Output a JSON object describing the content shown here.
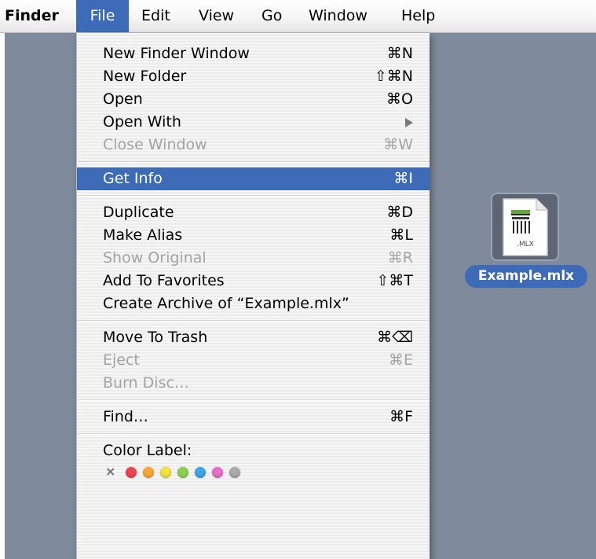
{
  "menubar": {
    "app": "Finder",
    "items": [
      "File",
      "Edit",
      "View",
      "Go",
      "Window",
      "Help"
    ]
  },
  "file_menu": {
    "groups": [
      [
        {
          "label": "New Finder Window",
          "shortcut": "⌘N",
          "enabled": true
        },
        {
          "label": "New Folder",
          "shortcut": "⇧⌘N",
          "enabled": true
        },
        {
          "label": "Open",
          "shortcut": "⌘O",
          "enabled": true
        },
        {
          "label": "Open With",
          "shortcut": "",
          "submenu": true,
          "enabled": true
        },
        {
          "label": "Close Window",
          "shortcut": "⌘W",
          "enabled": false
        }
      ],
      [
        {
          "label": "Get Info",
          "shortcut": "⌘I",
          "enabled": true,
          "highlighted": true
        }
      ],
      [
        {
          "label": "Duplicate",
          "shortcut": "⌘D",
          "enabled": true
        },
        {
          "label": "Make Alias",
          "shortcut": "⌘L",
          "enabled": true
        },
        {
          "label": "Show Original",
          "shortcut": "⌘R",
          "enabled": false
        },
        {
          "label": "Add To Favorites",
          "shortcut": "⇧⌘T",
          "enabled": true
        },
        {
          "label": "Create Archive of “Example.mlx”",
          "shortcut": "",
          "enabled": true
        }
      ],
      [
        {
          "label": "Move To Trash",
          "shortcut": "⌘⌫",
          "enabled": true
        },
        {
          "label": "Eject",
          "shortcut": "⌘E",
          "enabled": false
        },
        {
          "label": "Burn Disc…",
          "shortcut": "",
          "enabled": false
        }
      ],
      [
        {
          "label": "Find…",
          "shortcut": "⌘F",
          "enabled": true
        }
      ],
      [
        {
          "label": "Color Label:",
          "shortcut": "",
          "enabled": true
        }
      ]
    ],
    "color_labels": [
      "none",
      "red",
      "orange",
      "yellow",
      "green",
      "blue",
      "purple",
      "gray"
    ]
  },
  "colors": {
    "highlight": "#3d6bb8",
    "desktop": "#7f8a9c",
    "disabled_text": "#a3a3a3",
    "label_colors": {
      "red": "#f2444f",
      "orange": "#f9a732",
      "yellow": "#f3e33d",
      "green": "#8fd14e",
      "blue": "#3fa6e8",
      "purple": "#e86fcd",
      "gray": "#ababab"
    }
  },
  "desktop_file": {
    "name": "Example.mlx",
    "icon_caption": ".MLX",
    "icon": "document-icon"
  }
}
